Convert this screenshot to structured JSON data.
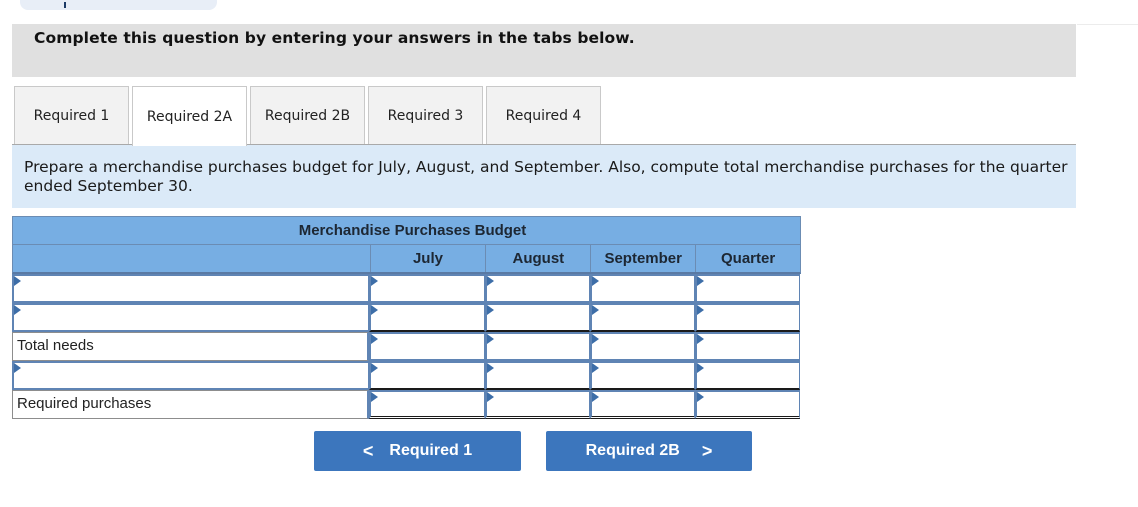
{
  "instructions": "Complete this question by entering your answers in the tabs below.",
  "tabs": [
    {
      "label": "Required 1",
      "active": false
    },
    {
      "label": "Required 2A",
      "active": true
    },
    {
      "label": "Required 2B",
      "active": false
    },
    {
      "label": "Required 3",
      "active": false
    },
    {
      "label": "Required 4",
      "active": false
    }
  ],
  "description": "Prepare a merchandise purchases budget for July, August, and September. Also, compute total merchandise purchases for the quarter ended September 30.",
  "budget": {
    "title": "Merchandise Purchases Budget",
    "columns": [
      "July",
      "August",
      "September",
      "Quarter"
    ],
    "rows": [
      {
        "label": "",
        "label_editable": true,
        "values": [
          "",
          "",
          "",
          ""
        ]
      },
      {
        "label": "",
        "label_editable": true,
        "values": [
          "",
          "",
          "",
          ""
        ]
      },
      {
        "label": "Total needs",
        "label_editable": false,
        "values": [
          "",
          "",
          "",
          ""
        ]
      },
      {
        "label": "",
        "label_editable": true,
        "values": [
          "",
          "",
          "",
          ""
        ]
      },
      {
        "label": "Required purchases",
        "label_editable": false,
        "values": [
          "",
          "",
          "",
          ""
        ]
      }
    ]
  },
  "nav": {
    "prev_label": "Required 1",
    "next_label": "Required 2B",
    "prev_icon": "chevron-left-icon",
    "next_icon": "chevron-right-icon",
    "prev_glyph": "<",
    "next_glyph": ">"
  },
  "colors": {
    "table_header": "#77aee3",
    "description_bg": "#dbeaf8",
    "button": "#3c76bd",
    "instruction_bg": "#e0e0e0"
  }
}
